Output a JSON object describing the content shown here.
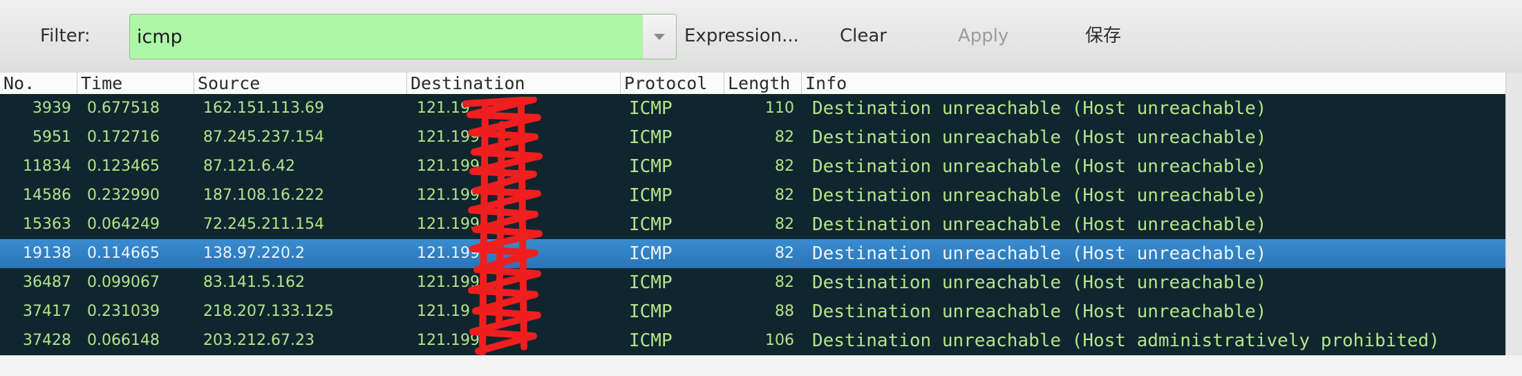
{
  "toolbar": {
    "filter_label": "Filter:",
    "filter_value": "icmp",
    "expression_label": "Expression...",
    "clear_label": "Clear",
    "apply_label": "Apply",
    "save_label": "保存",
    "filter_valid_color": "#aef7a6"
  },
  "columns": {
    "no": "No.",
    "time": "Time",
    "source": "Source",
    "destination": "Destination",
    "protocol": "Protocol",
    "length": "Length",
    "info": "Info"
  },
  "packets": [
    {
      "no": "3939",
      "time": "0.677518",
      "source": "162.151.113.69",
      "destination": "121.19",
      "protocol": "ICMP",
      "length": "110",
      "info": "Destination unreachable (Host unreachable)",
      "selected": false
    },
    {
      "no": "5951",
      "time": "0.172716",
      "source": "87.245.237.154",
      "destination": "121.199",
      "protocol": "ICMP",
      "length": "82",
      "info": "Destination unreachable (Host unreachable)",
      "selected": false
    },
    {
      "no": "11834",
      "time": "0.123465",
      "source": "87.121.6.42",
      "destination": "121.199",
      "protocol": "ICMP",
      "length": "82",
      "info": "Destination unreachable (Host unreachable)",
      "selected": false
    },
    {
      "no": "14586",
      "time": "0.232990",
      "source": "187.108.16.222",
      "destination": "121.199",
      "protocol": "ICMP",
      "length": "82",
      "info": "Destination unreachable (Host unreachable)",
      "selected": false
    },
    {
      "no": "15363",
      "time": "0.064249",
      "source": "72.245.211.154",
      "destination": "121.199",
      "protocol": "ICMP",
      "length": "82",
      "info": "Destination unreachable (Host unreachable)",
      "selected": false
    },
    {
      "no": "19138",
      "time": "0.114665",
      "source": "138.97.220.2",
      "destination": "121.199.",
      "protocol": "ICMP",
      "length": "82",
      "info": "Destination unreachable (Host unreachable)",
      "selected": true
    },
    {
      "no": "36487",
      "time": "0.099067",
      "source": "83.141.5.162",
      "destination": "121.199",
      "protocol": "ICMP",
      "length": "82",
      "info": "Destination unreachable (Host unreachable)",
      "selected": false
    },
    {
      "no": "37417",
      "time": "0.231039",
      "source": "218.207.133.125",
      "destination": "121.19",
      "protocol": "ICMP",
      "length": "88",
      "info": "Destination unreachable (Host unreachable)",
      "selected": false
    },
    {
      "no": "37428",
      "time": "0.066148",
      "source": "203.212.67.23",
      "destination": "121.199",
      "protocol": "ICMP",
      "length": "106",
      "info": "Destination unreachable (Host administratively prohibited)",
      "selected": false
    }
  ]
}
